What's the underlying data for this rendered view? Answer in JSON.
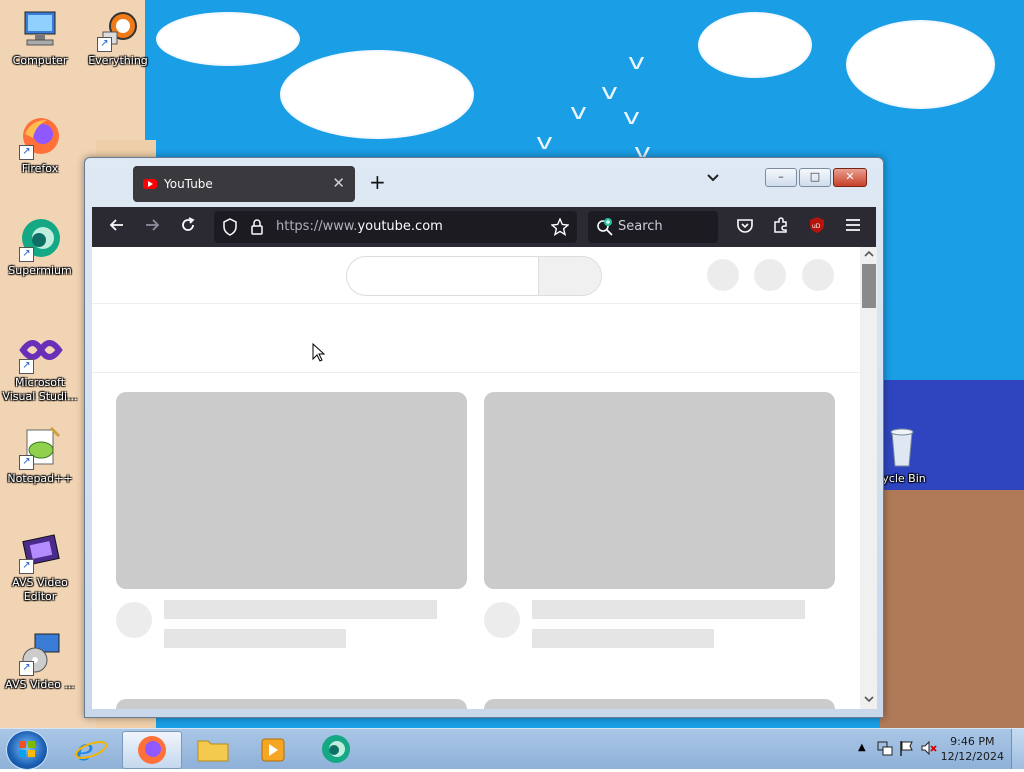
{
  "desktop": {
    "icons": [
      {
        "label": "Computer"
      },
      {
        "label": "Everything"
      },
      {
        "label": "Firefox"
      },
      {
        "label": "Supermium"
      },
      {
        "label": "Microsoft Visual Studi..."
      },
      {
        "label": "Notepad++"
      },
      {
        "label": "AVS Video Editor"
      },
      {
        "label": "AVS Video ..."
      },
      {
        "label": "cycle Bin"
      }
    ]
  },
  "browser": {
    "tab_title": "YouTube",
    "new_tab_glyph": "+",
    "url_gray": "https://www.",
    "url_host": "youtube.com",
    "search_placeholder": "Search"
  },
  "window_buttons": {
    "minimize": "–",
    "maximize": "□",
    "close": "✕"
  },
  "taskbar": {
    "time": "9:46 PM",
    "date": "12/12/2024"
  },
  "colors": {
    "wallpaper_sky": "#1a9ee6",
    "browser_toolbar": "#2b2a33",
    "tab_active": "#3a3a3e",
    "skeleton": "#cbcbcb"
  }
}
